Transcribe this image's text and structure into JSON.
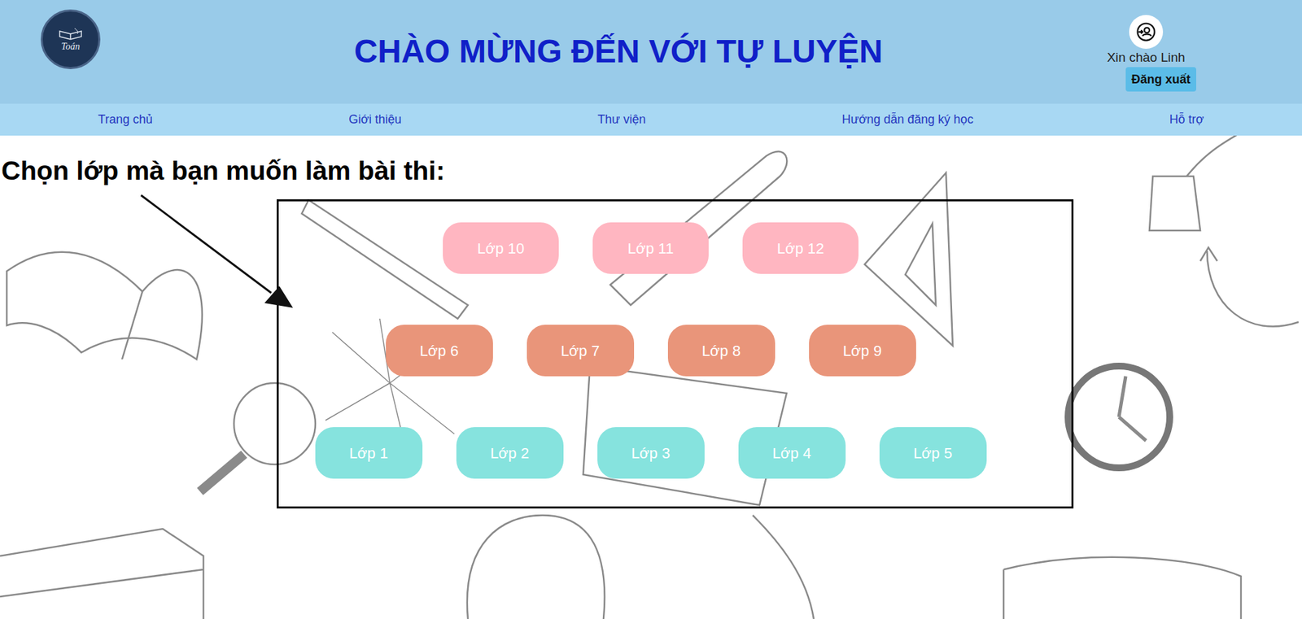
{
  "header": {
    "logo_text": "Toán",
    "title": "CHÀO MỪNG ĐẾN VỚI TỰ LUYỆN",
    "greeting": "Xin chào Linh",
    "logout_button": "Đăng xuất"
  },
  "nav": {
    "items": [
      "Trang chủ",
      "Giới thiệu",
      "Thư viện",
      "Hướng dẫn đăng ký học",
      "Hỗ trợ"
    ]
  },
  "heading": "Chọn lớp mà bạn muốn làm bài thi:",
  "grade_rows": [
    {
      "color": "#ffb6c1",
      "grades": [
        "Lớp 10",
        "Lớp 11",
        "Lớp 12"
      ]
    },
    {
      "color": "#e9957a",
      "grades": [
        "Lớp 6",
        "Lớp 7",
        "Lớp 8",
        "Lớp 9"
      ]
    },
    {
      "color": "#86e3de",
      "grades": [
        "Lớp 1",
        "Lớp 2",
        "Lớp 3",
        "Lớp 4",
        "Lớp 5"
      ]
    }
  ]
}
